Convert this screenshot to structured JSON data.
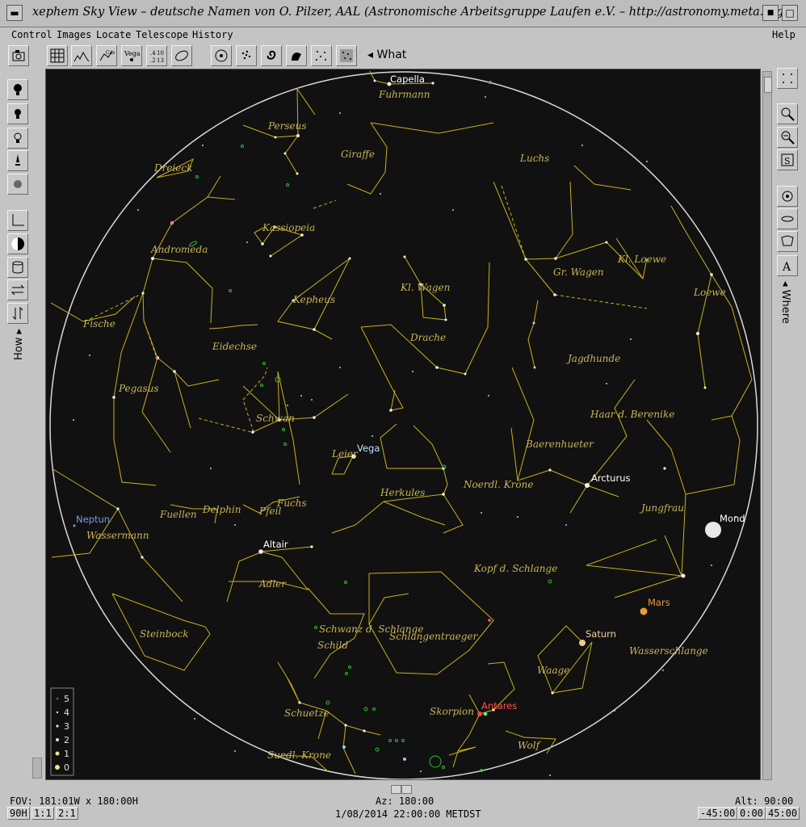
{
  "window": {
    "title": "xephem Sky View – deutsche Namen von O. Pilzer, AAL (Astronomische Arbeitsgruppe Laufen e.V. – http://astronomy.meta.org)"
  },
  "menu": {
    "items": [
      "Control",
      "Images",
      "Locate",
      "Telescope",
      "History"
    ],
    "help": "Help"
  },
  "toolbar": {
    "what_label": "What"
  },
  "side_labels": {
    "how": "How",
    "where": "Where"
  },
  "sky": {
    "constellations": [
      "Capella",
      "Fuhrmann",
      "Perseus",
      "Giraffe",
      "Luchs",
      "Dreieck",
      "Andromeda",
      "Kassiopeia",
      "Kl. Loewe",
      "Gr. Wagen",
      "Kl. Wagen",
      "Kepheus",
      "Loewe",
      "Fische",
      "Eidechse",
      "Drache",
      "Jagdhunde",
      "Pegasus",
      "Schwan",
      "Haar d. Berenike",
      "Baerenhueter",
      "Leier",
      "Herkules",
      "Noerdl. Krone",
      "Fuchs",
      "Delphin",
      "Fuellen",
      "Pfeil",
      "Jungfrau",
      "Wassermann",
      "Adler",
      "Kopf d. Schlange",
      "Steinbock",
      "Schwanz d. Schlange",
      "Schlangentraeger",
      "Schild",
      "Waage",
      "Wasserschlange",
      "Schuetze",
      "Skorpion",
      "Wolf",
      "Suedl. Krone"
    ],
    "objects": {
      "vega": "Vega",
      "arcturus": "Arcturus",
      "mond": "Mond",
      "neptun": "Neptun",
      "altair": "Altair",
      "mars": "Mars",
      "saturn": "Saturn",
      "antares": "Antares",
      "capella": "Capella"
    },
    "legend": [
      "5",
      "4",
      "3",
      "2",
      "1",
      "0"
    ]
  },
  "colors": {
    "constellation_line": "#c8b020",
    "sky_background": "#111111",
    "mars": "#e89a40",
    "antares": "#ff4040",
    "neptun": "#7a9ae8",
    "deep_sky": "#30c030"
  },
  "status": {
    "fov": "FOV: 181:01W x 180:00H",
    "az": "Az: 180:00",
    "alt": "Alt: 90:00",
    "datetime": "1/08/2014 22:00:00 METDST",
    "btn_90h": "90H",
    "btn_11": "1:1",
    "btn_21": "2:1",
    "btn_m45": "-45:00",
    "btn_0": "0:00",
    "btn_45": "45:00"
  }
}
